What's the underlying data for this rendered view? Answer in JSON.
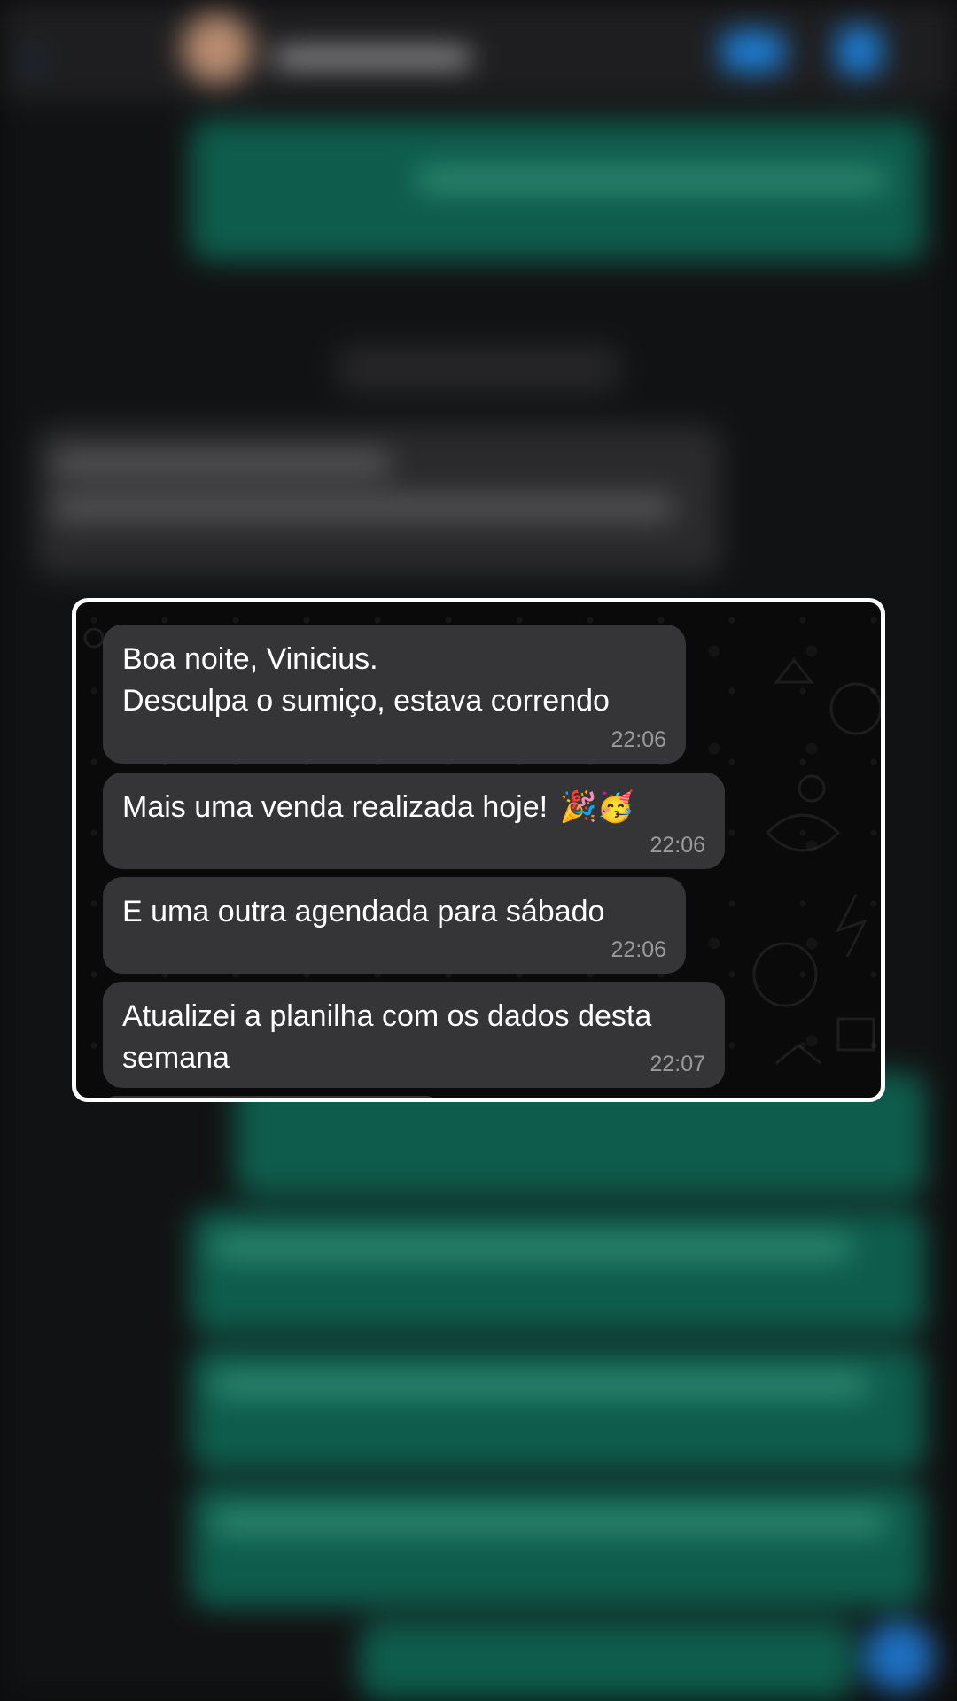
{
  "messages": [
    {
      "text": "Boa noite, Vinicius.\nDesculpa o sumiço, estava correndo",
      "time": "22:06"
    },
    {
      "text": "Mais uma venda realizada hoje!",
      "emoji": "🎉🥳",
      "time": "22:06"
    },
    {
      "text": "E uma outra agendada para sábado",
      "time": "22:06"
    },
    {
      "text": "Atualizei a planilha com os dados desta semana",
      "time": "22:07"
    }
  ],
  "colors": {
    "incoming_bubble": "#353537",
    "outgoing_bubble": "#0e5c4c",
    "popup_border": "#ffffff",
    "timestamp": "#9a9a9e",
    "accent": "#1d7fd6"
  },
  "icons": [
    "back-chevron-icon",
    "video-call-icon",
    "phone-call-icon",
    "party-popper-emoji",
    "partying-face-emoji"
  ]
}
